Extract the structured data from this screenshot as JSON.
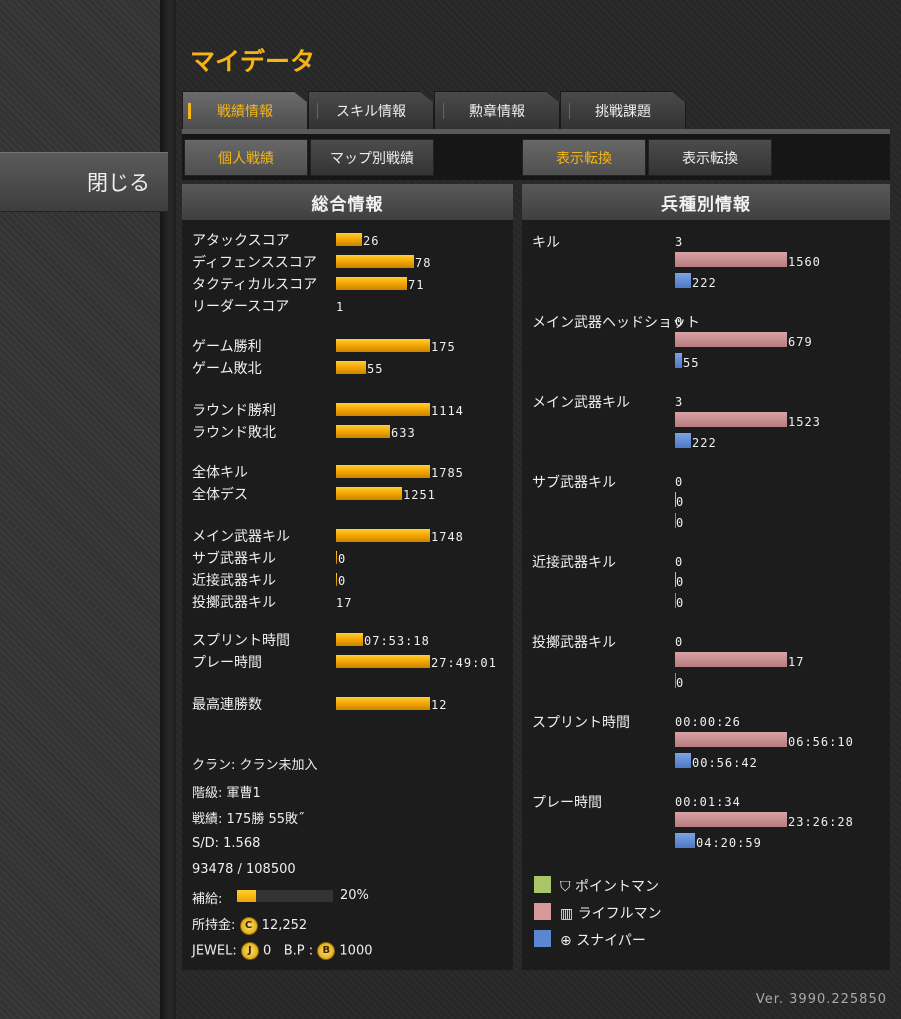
{
  "title": "マイデータ",
  "close_label": "閉じる",
  "tabs": [
    "戦績情報",
    "スキル情報",
    "勲章情報",
    "挑戦課題"
  ],
  "subtabs": [
    "個人戦績",
    "マップ別戦績"
  ],
  "toggles": [
    "表示転換",
    "表示転換"
  ],
  "overall": {
    "header": "総合情報",
    "rows": [
      {
        "label": "アタックスコア",
        "value": "26",
        "fill": 0.26
      },
      {
        "label": "ディフェンススコア",
        "value": "78",
        "fill": 0.78
      },
      {
        "label": "タクティカルスコア",
        "value": "71",
        "fill": 0.71
      },
      {
        "label": "リーダースコア",
        "value": "1",
        "fill": 0
      },
      {
        "label": "ゲーム勝利",
        "value": "175",
        "fill": 0.94
      },
      {
        "label": "ゲーム敗北",
        "value": "55",
        "fill": 0.3
      },
      {
        "label": "ラウンド勝利",
        "value": "1114",
        "fill": 0.94
      },
      {
        "label": "ラウンド敗北",
        "value": "633",
        "fill": 0.54
      },
      {
        "label": "全体キル",
        "value": "1785",
        "fill": 0.94
      },
      {
        "label": "全体デス",
        "value": "1251",
        "fill": 0.66
      },
      {
        "label": "メイン武器キル",
        "value": "1748",
        "fill": 0.94
      },
      {
        "label": "サブ武器キル",
        "value": "0",
        "fill": 0.01
      },
      {
        "label": "近接武器キル",
        "value": "0",
        "fill": 0.01
      },
      {
        "label": "投擲武器キル",
        "value": "17",
        "fill": 0
      },
      {
        "label": "スプリント時間",
        "value": "07:53:18",
        "fill": 0.27
      },
      {
        "label": "プレー時間",
        "value": "27:49:01",
        "fill": 0.94
      },
      {
        "label": "最高連勝数",
        "value": "12",
        "fill": 0.94
      }
    ],
    "clan": "クラン: クラン未加入",
    "rank": "階級: 軍曹1",
    "record": "戦績: 175勝 55敗˝",
    "sd": "S/D: 1.568",
    "exp": "93478 / 108500",
    "supply_label": "補給:",
    "supply_pct": "20%",
    "supply_fill": 0.2,
    "money_label": "所持金:",
    "money": "12,252",
    "money_coin": "C",
    "jewel_label": "JEWEL:",
    "jewel_coin": "J",
    "jewel": "0",
    "bp_label": "B.P :",
    "bp_coin": "B",
    "bp": "1000"
  },
  "by_class": {
    "header": "兵種別情報",
    "groups": [
      {
        "label": "キル",
        "a": "3",
        "b": "1560",
        "b_fill": 1,
        "c": "222",
        "c_fill": 0.14
      },
      {
        "label": "メイン武器ヘッドショット",
        "a": "0",
        "b": "679",
        "b_fill": 1,
        "c": "55",
        "c_fill": 0.06
      },
      {
        "label": "メイン武器キル",
        "a": "3",
        "b": "1523",
        "b_fill": 1,
        "c": "222",
        "c_fill": 0.14
      },
      {
        "label": "サブ武器キル",
        "a": "0",
        "b": "0",
        "b_fill": 0,
        "c": "0",
        "c_fill": 0
      },
      {
        "label": "近接武器キル",
        "a": "0",
        "b": "0",
        "b_fill": 0,
        "c": "0",
        "c_fill": 0
      },
      {
        "label": "投擲武器キル",
        "a": "0",
        "b": "17",
        "b_fill": 1,
        "c": "0",
        "c_fill": 0
      },
      {
        "label": "スプリント時間",
        "a": "00:00:26",
        "b": "06:56:10",
        "b_fill": 1,
        "c": "00:56:42",
        "c_fill": 0.14
      },
      {
        "label": "プレー時間",
        "a": "00:01:34",
        "b": "23:26:28",
        "b_fill": 1,
        "c": "04:20:59",
        "c_fill": 0.18
      }
    ],
    "legend": [
      {
        "label": "ポイントマン",
        "color": "#a9c66a"
      },
      {
        "label": "ライフルマン",
        "color": "#d79a9a"
      },
      {
        "label": "スナイパー",
        "color": "#5a86d2"
      }
    ]
  },
  "version": "Ver. 3990.225850"
}
